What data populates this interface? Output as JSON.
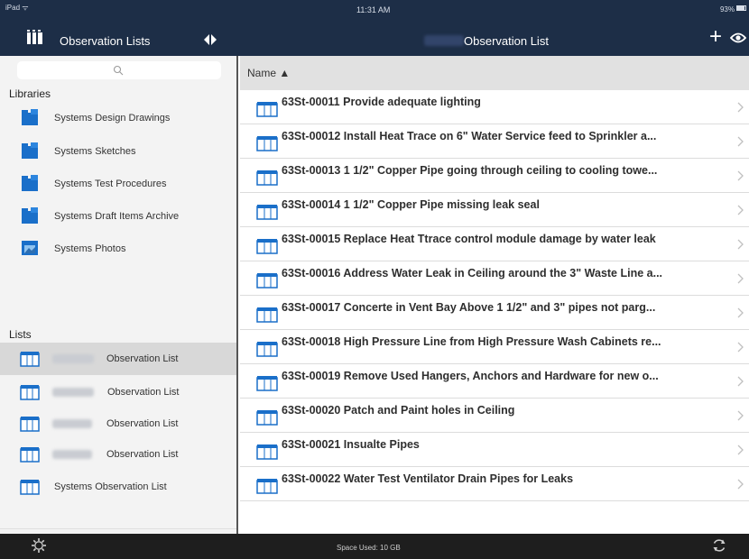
{
  "status": {
    "device": "iPad ᯤ",
    "time": "11:31 AM",
    "battery": "93%"
  },
  "sidebar": {
    "title": "Observation Lists",
    "search_placeholder": "",
    "libraries_header": "Libraries",
    "libraries": [
      {
        "label": "Systems Design Drawings",
        "icon": "folder-icon"
      },
      {
        "label": "Systems Sketches",
        "icon": "folder-icon"
      },
      {
        "label": "Systems Test Procedures",
        "icon": "folder-icon"
      },
      {
        "label": "Systems Draft Items Archive",
        "icon": "folder-icon"
      },
      {
        "label": "Systems Photos",
        "icon": "photo-folder-icon"
      }
    ],
    "lists_header": "Lists",
    "lists": [
      {
        "label": "Observation List",
        "selected": true
      },
      {
        "label": "Observation List",
        "selected": false
      },
      {
        "label": "Observation List",
        "selected": false
      },
      {
        "label": "Observation List",
        "selected": false
      },
      {
        "label": "Systems Observation List",
        "selected": false
      }
    ]
  },
  "main": {
    "title": "Observation List",
    "column_header": "Name ▲",
    "rows": [
      "63St-00011 Provide adequate lighting",
      "63St-00012 Install Heat Trace on 6\" Water Service feed to Sprinkler a...",
      "63St-00013 1 1/2\" Copper Pipe going through ceiling to cooling towe...",
      "63St-00014 1 1/2\" Copper Pipe missing leak seal",
      "63St-00015 Replace Heat Ttrace control module damage by water leak",
      "63St-00016 Address Water Leak in Ceiling around the 3\" Waste Line a...",
      "63St-00017 Concerte in Vent Bay Above 1 1/2\" and 3\" pipes not parg...",
      "63St-00018 High Pressure Line from High Pressure Wash Cabinets re...",
      "63St-00019 Remove Used Hangers, Anchors and Hardware for new o...",
      "63St-00020 Patch and Paint holes in Ceiling",
      "63St-00021 Insualte Pipes",
      "63St-00022 Water Test Ventilator Drain Pipes for Leaks"
    ]
  },
  "footer": {
    "space_used": "Space Used: 10 GB"
  },
  "colors": {
    "header_bg": "#1d2e47",
    "accent_blue": "#1a6fc9",
    "footer_bg": "#1e1e1e",
    "selected_bg": "#d8d8d8"
  }
}
